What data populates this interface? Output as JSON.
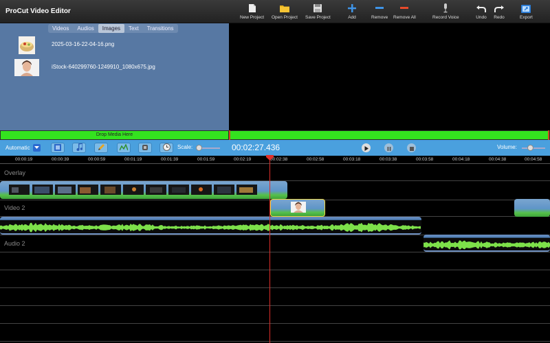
{
  "app": {
    "title": "ProCut Video Editor"
  },
  "toolbar": {
    "new_project": "New Project",
    "open_project": "Open Project",
    "save_project": "Save Project",
    "add": "Add",
    "remove": "Remove",
    "remove_all": "Remove All",
    "record_voice": "Record Voice",
    "undo": "Undo",
    "redo": "Redo",
    "export": "Export"
  },
  "media_tabs": [
    "Videos",
    "Audios",
    "Images",
    "Text",
    "Transitions"
  ],
  "media_active_tab": "Images",
  "media_items": [
    {
      "name": "2025-03-16-22-04-16.png"
    },
    {
      "name": "iStock-640299760-1249910_1080x675.jpg"
    }
  ],
  "drop_label": "Drop Media Here",
  "controls": {
    "mode": "Automatic",
    "scale_label": "Scale:",
    "timecode": "00:02:27.436",
    "volume_label": "Volume:"
  },
  "ruler": [
    "00:00:19",
    "00:00:39",
    "00:00:59",
    "00:01:19",
    "00:01:39",
    "00:01:59",
    "00:02:19",
    "00:02:38",
    "00:02:58",
    "00:03:18",
    "00:03:38",
    "00:03:58",
    "00:04:18",
    "00:04:38",
    "00:04:58"
  ],
  "tracks": [
    {
      "name": "Overlay"
    },
    {
      "name": "Video 2"
    },
    {
      "name": "Audio 2"
    }
  ],
  "colors": {
    "accent": "#4aa0de",
    "clip_green": "#7de04a",
    "playhead": "#e0302b",
    "media_panel": "#5778a3"
  }
}
